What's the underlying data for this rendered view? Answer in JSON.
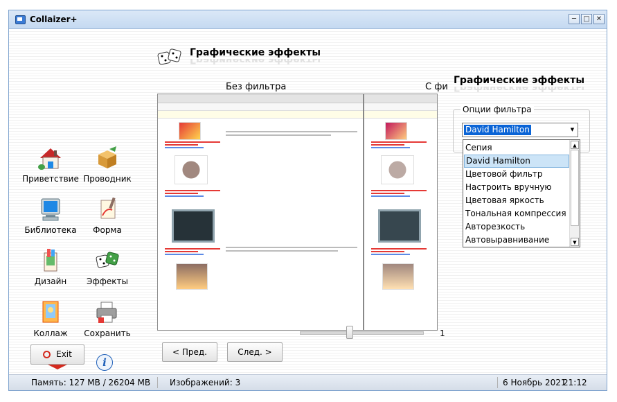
{
  "window": {
    "title": "Collaizer+",
    "minimize_label": "─",
    "maximize_label": "□",
    "close_label": "✕"
  },
  "nav": {
    "items": [
      {
        "label": "Приветствие",
        "icon": "home-icon"
      },
      {
        "label": "Проводник",
        "icon": "package-icon"
      },
      {
        "label": "Библиотека",
        "icon": "monitor-icon"
      },
      {
        "label": "Форма",
        "icon": "brush-icon"
      },
      {
        "label": "Дизайн",
        "icon": "paint-tube-icon"
      },
      {
        "label": "Эффекты",
        "icon": "dice-icon"
      },
      {
        "label": "Коллаж",
        "icon": "frame-icon"
      },
      {
        "label": "Сохранить",
        "icon": "printer-icon"
      }
    ],
    "exit_label": "Exit"
  },
  "main": {
    "header_title": "Графические эффекты",
    "without_filter_label": "Без фильтра",
    "with_filter_label": "С фи",
    "prev_label": "< Пред.",
    "next_label": "След. >",
    "slider_value": "1",
    "slider_fraction": 0.4
  },
  "panel": {
    "title": "Графические эффекты",
    "group_label": "Опции фильтра",
    "selected": "David Hamilton",
    "options": [
      "Сепия",
      "David Hamilton",
      "Цветовой фильтр",
      "Настроить вручную",
      "Цветовая яркость",
      "Тональная компрессия",
      "Авторезкость",
      "Автовыравнивание"
    ]
  },
  "status": {
    "memory": "Память: 127 MB / 26204 MB",
    "images": "Изображений: 3",
    "date": "6 Ноябрь 2021",
    "time": "21:12"
  },
  "colors": {
    "accent": "#0a64d6",
    "title_bar": "#c4d9f1",
    "dropdown_selected": "#cce4f7",
    "exit_red": "#d42a1e"
  }
}
